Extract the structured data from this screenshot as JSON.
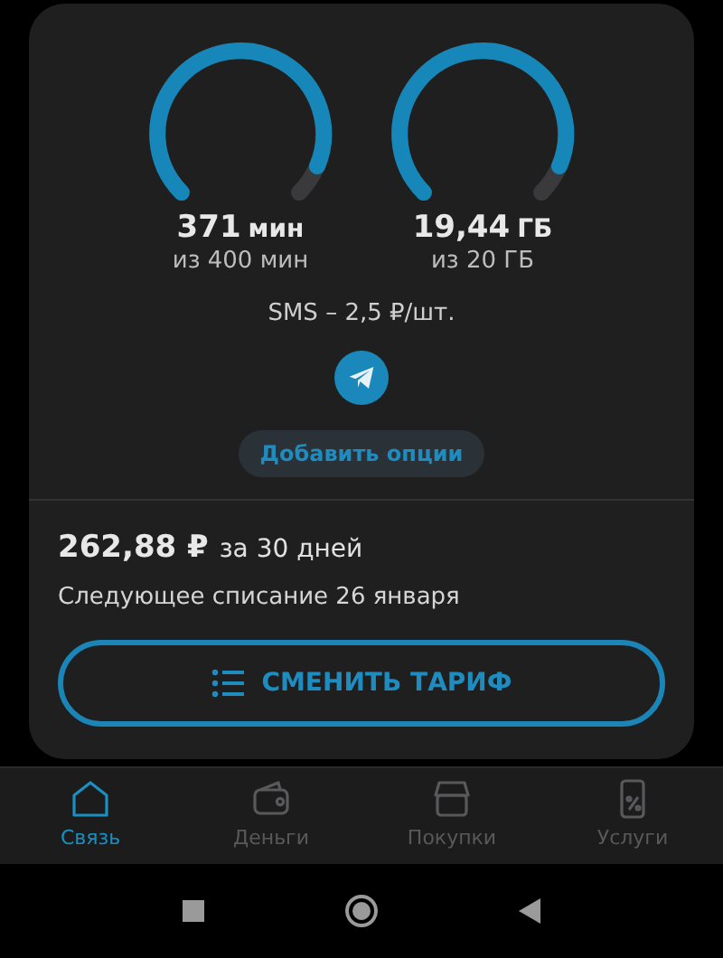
{
  "gauges": [
    {
      "value": "371",
      "unit": "мин",
      "caption": "из 400 мин"
    },
    {
      "value": "19,44",
      "unit": "ГБ",
      "caption": "из 20 ГБ"
    }
  ],
  "sms": "SMS – 2,5 ₽/шт.",
  "options_button": "Добавить опции",
  "price": {
    "amount": "262,88 ₽",
    "period": "за 30 дней"
  },
  "next_charge": "Следующее списание 26 января",
  "change_button": "СМЕНИТЬ ТАРИФ",
  "nav": [
    {
      "kind": "home",
      "label": "Связь",
      "selected": true
    },
    {
      "kind": "wallet",
      "label": "Деньги",
      "selected": false
    },
    {
      "kind": "shop",
      "label": "Покупки",
      "selected": false
    },
    {
      "kind": "services",
      "label": "Услуги",
      "selected": false
    }
  ]
}
